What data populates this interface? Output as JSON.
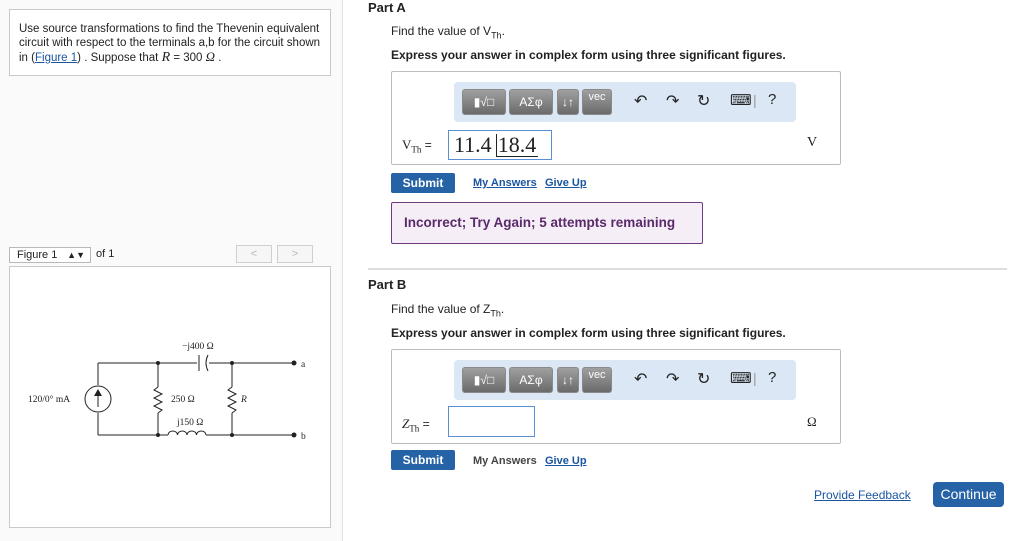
{
  "problem": {
    "text_before_link": "Use source transformations to find the Thevenin equivalent circuit with respect to the terminals a,b for the circuit shown in (",
    "figure_link": "Figure 1",
    "text_after_link": ") . Suppose that ",
    "var": "R",
    "equals": " = 300 ",
    "unit": "Ω",
    "end": " ."
  },
  "figure_nav": {
    "select_value": "Figure 1",
    "of_text": "of 1",
    "prev": "<",
    "next": ">"
  },
  "circuit": {
    "source_label": "120/0° mA",
    "cap_label": "−j400 Ω",
    "r250_label": "250 Ω",
    "r_label": "R",
    "ind_label": "j150 Ω",
    "term_a": "a",
    "term_b": "b"
  },
  "toolbar": {
    "templates": "▮√□",
    "greek": "ΑΣφ",
    "updown": "↓↑",
    "vec": "vec",
    "undo": "↶",
    "redo": "↷",
    "reset": "↻",
    "keyboard": "⌨",
    "help": "?"
  },
  "partA": {
    "title": "Part A",
    "prompt": "Find the value of V",
    "prompt_sub": "Th",
    "prompt_end": ".",
    "instruction": "Express your answer in complex form using three significant figures.",
    "label": "V",
    "label_sub": "Th",
    "equals": " =",
    "answer_mag": "11.4",
    "answer_angle": "18.4",
    "unit": "V",
    "submit": "Submit",
    "my_answers": "My Answers",
    "give_up": "Give Up",
    "feedback": "Incorrect; Try Again; 5 attempts remaining"
  },
  "partB": {
    "title": "Part B",
    "prompt": "Find the value of Z",
    "prompt_sub": "Th",
    "prompt_end": ".",
    "instruction": "Express your answer in complex form using three significant figures.",
    "label": "Z",
    "label_sub": "Th",
    "equals": " =",
    "answer": "",
    "unit": "Ω",
    "submit": "Submit",
    "my_answers": "My Answers",
    "give_up": "Give Up"
  },
  "footer": {
    "provide_feedback": "Provide Feedback",
    "continue": "Continue"
  }
}
